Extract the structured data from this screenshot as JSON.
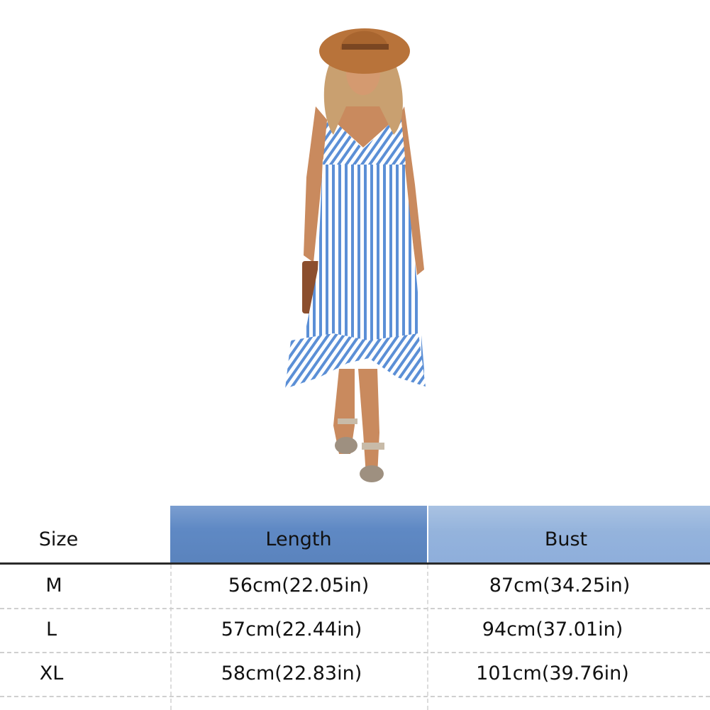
{
  "table": {
    "headers": {
      "size": "Size",
      "length": "Length",
      "bust": "Bust"
    },
    "rows": [
      {
        "size": "M",
        "length": "56cm(22.05in)",
        "bust": "87cm(34.25in)"
      },
      {
        "size": "L",
        "length": "57cm(22.44in)",
        "bust": "94cm(37.01in)"
      },
      {
        "size": "XL",
        "length": "58cm(22.83in)",
        "bust": "101cm(39.76in)"
      }
    ]
  },
  "colors": {
    "length_header": "#5f89c4",
    "bust_header": "#94b3dc",
    "dress_stripe": "#5b8fd6",
    "hat": "#b8733a"
  }
}
